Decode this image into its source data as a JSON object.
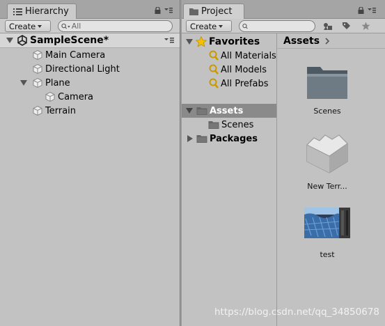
{
  "hierarchy": {
    "tab_label": "Hierarchy",
    "create_label": "Create",
    "search_placeholder": "All",
    "scene_name": "SampleScene*",
    "items": [
      {
        "label": "Main Camera"
      },
      {
        "label": "Directional Light"
      },
      {
        "label": "Plane"
      },
      {
        "label": "Camera"
      },
      {
        "label": "Terrain"
      }
    ]
  },
  "project": {
    "tab_label": "Project",
    "create_label": "Create",
    "search_placeholder": "",
    "favorites": {
      "label": "Favorites",
      "items": [
        {
          "label": "All Materials"
        },
        {
          "label": "All Models"
        },
        {
          "label": "All Prefabs"
        }
      ]
    },
    "assets_folder": {
      "label": "Assets",
      "children": [
        {
          "label": "Scenes"
        }
      ]
    },
    "packages_label": "Packages",
    "breadcrumb": "Assets",
    "assets": [
      {
        "label": "Scenes",
        "icon": "folder-icon"
      },
      {
        "label": "New Terr...",
        "icon": "terrain-icon"
      },
      {
        "label": "test",
        "icon": "texture-thumbnail"
      }
    ]
  },
  "watermark": "https://blog.csdn.net/qq_34850678",
  "colors": {
    "panel_bg": "#c2c2c2",
    "selection": "#8a8a8a",
    "favorite_star": "#f5c000"
  }
}
